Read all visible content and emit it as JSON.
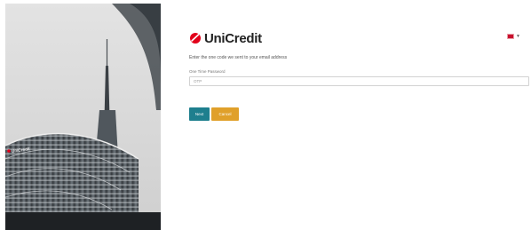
{
  "brand": {
    "name": "UniCredit",
    "accent": "#e2001a"
  },
  "hero": {
    "sign_text": "UniCredit"
  },
  "language": {
    "flag_color": "#c8102e",
    "chevron_icon": "chevron-down-icon"
  },
  "form": {
    "instruction": "Enter the one code we sent to your email address",
    "field_label": "One Time Password",
    "otp_value": "",
    "otp_placeholder": "OTP"
  },
  "buttons": {
    "next_label": "Next",
    "next_color": "#1e7f8e",
    "cancel_label": "Cancel",
    "cancel_color": "#e0a02a"
  }
}
